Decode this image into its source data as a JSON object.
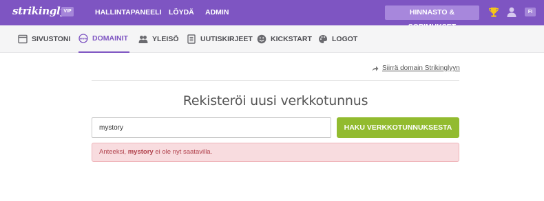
{
  "brand": {
    "logo": "strikingly",
    "badge": "VIP"
  },
  "topnav": {
    "items": [
      {
        "label": "HALLINTAPANEELI"
      },
      {
        "label": "LÖYDÄ"
      },
      {
        "label": "ADMIN"
      }
    ],
    "pricing_label": "HINNASTO & SOPIMUKSET",
    "lang": "FI"
  },
  "subnav": {
    "tabs": [
      {
        "label": "SIVUSTONI",
        "icon": "site-icon",
        "active": false
      },
      {
        "label": "DOMAINIT",
        "icon": "www-icon",
        "active": true
      },
      {
        "label": "YLEISÖ",
        "icon": "audience-icon",
        "active": false
      },
      {
        "label": "UUTISKIRJEET",
        "icon": "newsletter-icon",
        "active": false
      },
      {
        "label": "KICKSTART",
        "icon": "smiley-icon",
        "active": false
      },
      {
        "label": "LOGOT",
        "icon": "palette-icon",
        "active": false
      }
    ]
  },
  "main": {
    "transfer_link": "Siirrä domain Strikinglyyn",
    "heading": "Rekisteröi uusi verkkotunnus",
    "search": {
      "value": "mystory",
      "button_label": "HAKU VERKKOTUNNUKSESTA"
    },
    "alert": {
      "prefix": "Anteeksi, ",
      "domain": "mystory",
      "suffix": " ei ole nyt saatavilla."
    }
  },
  "colors": {
    "brand_purple": "#7e55c2",
    "button_green": "#92bb2f",
    "alert_bg": "#f8dcdf",
    "alert_text": "#b0404b"
  }
}
